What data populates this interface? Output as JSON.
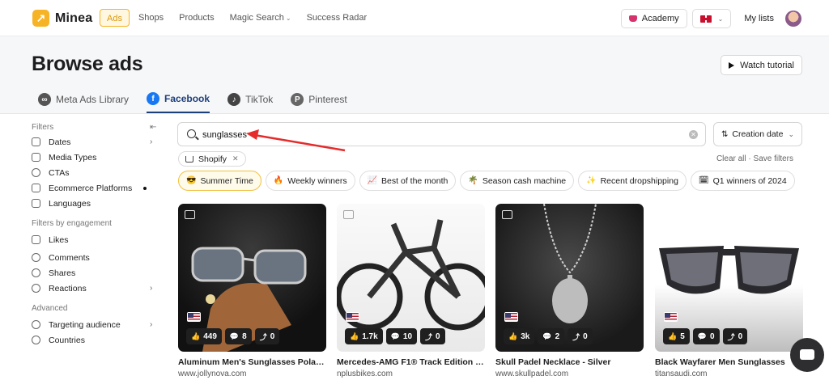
{
  "brand": {
    "name": "Minea"
  },
  "nav": {
    "links": [
      {
        "label": "Ads",
        "active": true
      },
      {
        "label": "Shops"
      },
      {
        "label": "Products"
      },
      {
        "label": "Magic Search"
      },
      {
        "label": "Success Radar"
      }
    ],
    "academy_label": "Academy",
    "language_flag": "uk-flag-icon",
    "my_lists_label": "My lists"
  },
  "header": {
    "title": "Browse ads",
    "watch_tutorial_label": "Watch tutorial",
    "tabs": [
      {
        "label": "Meta Ads Library",
        "icon": "meta-icon"
      },
      {
        "label": "Facebook",
        "icon": "facebook-icon",
        "active": true
      },
      {
        "label": "TikTok",
        "icon": "tiktok-icon"
      },
      {
        "label": "Pinterest",
        "icon": "pinterest-icon"
      }
    ]
  },
  "sidebar": {
    "filters_heading": "Filters",
    "filters": [
      {
        "label": "Dates",
        "icon": "calendar-icon",
        "chevron": true
      },
      {
        "label": "Media Types",
        "icon": "video-icon"
      },
      {
        "label": "CTAs",
        "icon": "target-icon"
      },
      {
        "label": "Ecommerce Platforms",
        "icon": "cart-icon",
        "dot": true
      },
      {
        "label": "Languages",
        "icon": "translate-icon"
      }
    ],
    "engagement_heading": "Filters by engagement",
    "engagement": [
      {
        "label": "Likes",
        "icon": "thumbs-up-icon"
      },
      {
        "label": "Comments",
        "icon": "comment-icon"
      },
      {
        "label": "Shares",
        "icon": "share-icon"
      },
      {
        "label": "Reactions",
        "icon": "smile-icon",
        "chevron": true
      }
    ],
    "advanced_heading": "Advanced",
    "advanced": [
      {
        "label": "Targeting audience",
        "icon": "user-icon",
        "chevron": true
      },
      {
        "label": "Countries",
        "icon": "globe-icon"
      }
    ]
  },
  "search": {
    "value": "sunglasses",
    "placeholder": ""
  },
  "sort": {
    "label": "Creation date"
  },
  "active_filter": {
    "label": "Shopify"
  },
  "clear_all_label": "Clear all",
  "separator": "·",
  "save_filters_label": "Save filters",
  "presets": [
    {
      "emoji": "😎",
      "label": "Summer Time",
      "active": true
    },
    {
      "emoji": "🔥",
      "label": "Weekly winners"
    },
    {
      "emoji": "📈",
      "label": "Best of the month"
    },
    {
      "emoji": "🌴",
      "label": "Season cash machine"
    },
    {
      "emoji": "✨",
      "label": "Recent dropshipping"
    },
    {
      "emoji": "🗓",
      "label": "Q1 winners of 2024"
    }
  ],
  "cards": [
    {
      "title": "Aluminum Men's Sunglasses Polarized…",
      "domain": "www.jollynova.com",
      "likes": "449",
      "comments": "8",
      "shares": "0",
      "country": "us-flag-icon"
    },
    {
      "title": "Mercedes-AMG F1® Track Edition 25…",
      "domain": "nplusbikes.com",
      "likes": "1.7k",
      "comments": "10",
      "shares": "0",
      "country": "us-flag-icon"
    },
    {
      "title": "Skull Padel Necklace - Silver",
      "domain": "www.skullpadel.com",
      "likes": "3k",
      "comments": "2",
      "shares": "0",
      "country": "us-flag-icon"
    },
    {
      "title": "Black Wayfarer Men Sunglasses",
      "domain": "titansaudi.com",
      "likes": "5",
      "comments": "0",
      "shares": "0",
      "country": "us-flag-icon"
    }
  ],
  "colors": {
    "accent": "#f6b325",
    "facebook_blue": "#1d3f7a"
  }
}
